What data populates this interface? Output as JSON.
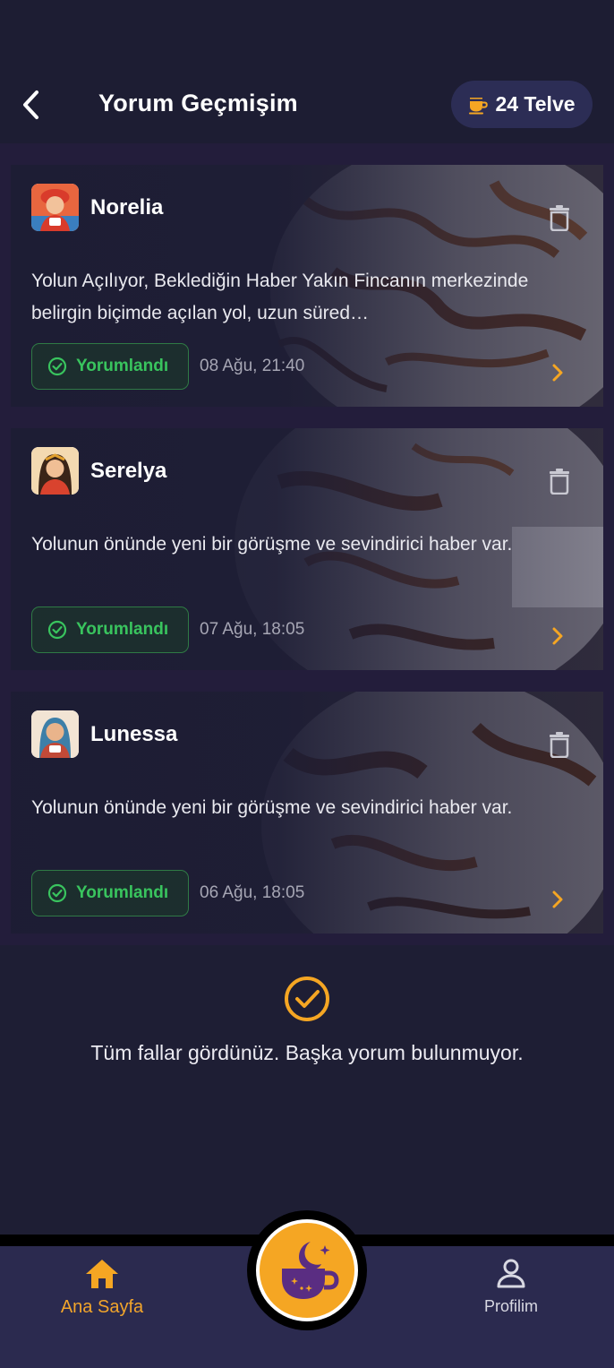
{
  "header": {
    "title": "Yorum Geçmişim",
    "telve_count": "24 Telve",
    "back_icon": "chevron-left-icon",
    "telve_icon": "coffee-cup-icon"
  },
  "readings": [
    {
      "reader": "Norelia",
      "text": "Yolun Açılıyor, Beklediğin Haber Yakın Fincanın merkezinde belirgin biçimde açılan yol, uzun süred…",
      "status": "Yorumlandı",
      "date": "08 Ağu, 21:40"
    },
    {
      "reader": "Serelya",
      "text": "Yolunun önünde yeni bir görüşme ve sevindirici haber var.",
      "status": "Yorumlandı",
      "date": "07 Ağu, 18:05"
    },
    {
      "reader": "Lunessa",
      "text": "Yolunun önünde yeni bir görüşme ve sevindirici haber var.",
      "status": "Yorumlandı",
      "date": "06 Ağu, 18:05"
    }
  ],
  "end_message": "Tüm fallar gördünüz. Başka yorum bulunmuyor.",
  "bottom_nav": {
    "home_label": "Ana Sayfa",
    "profile_label": "Profilim"
  },
  "colors": {
    "accent": "#f5a623",
    "status_green": "#39c45e",
    "background": "#1e1e34",
    "nav_background": "#2b2a4f"
  }
}
